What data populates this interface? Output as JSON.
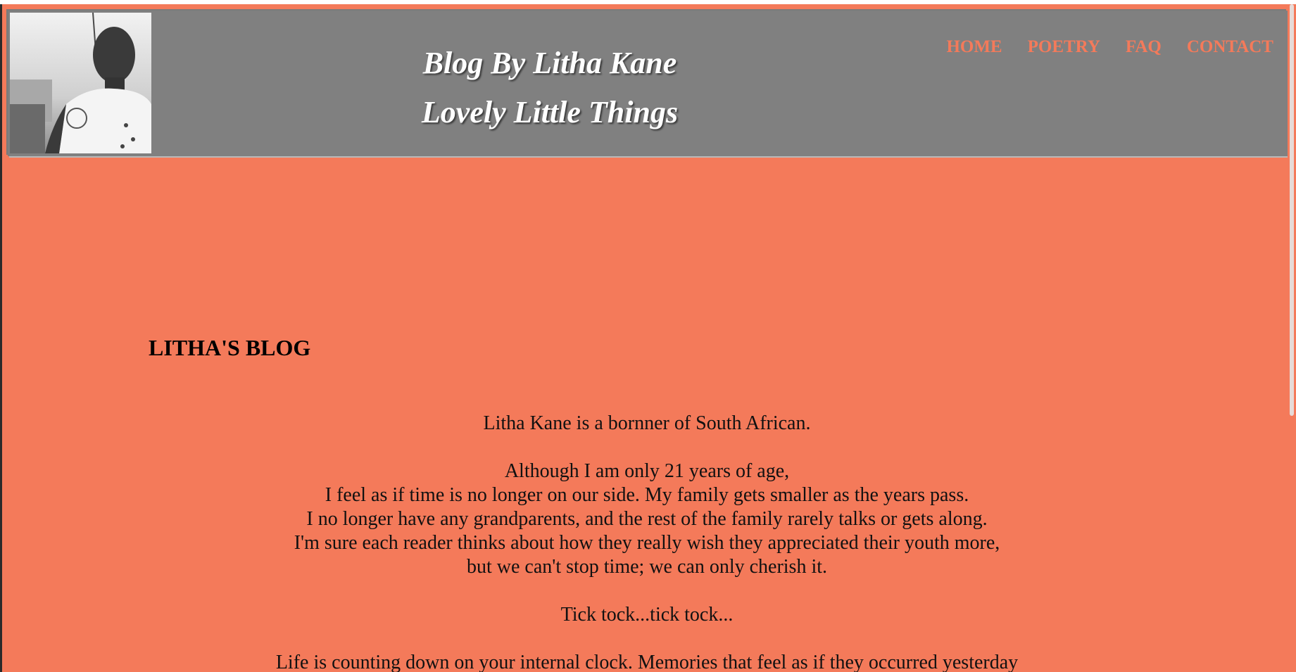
{
  "header": {
    "title": "Blog By Litha Kane",
    "subtitle": "Lovely Little Things",
    "avatar_alt": "Profile photo"
  },
  "nav": {
    "items": [
      {
        "label": "HOME"
      },
      {
        "label": "POETRY"
      },
      {
        "label": "FAQ"
      },
      {
        "label": "CONTACT"
      }
    ]
  },
  "main": {
    "heading": "LITHA'S BLOG",
    "paragraphs": [
      [
        "Litha Kane is a bornner of South African."
      ],
      [
        "Although I am only 21 years of age,",
        "I feel as if time is no longer on our side. My family gets smaller as the years pass.",
        "I no longer have any grandparents, and the rest of the family rarely talks or gets along.",
        "I'm sure each reader thinks about how they really wish they appreciated their youth more,",
        "but we can't stop time; we can only cherish it."
      ],
      [
        "Tick tock...tick tock..."
      ],
      [
        "Life is counting down on your internal clock. Memories that feel as if they occurred yesterday"
      ]
    ]
  },
  "colors": {
    "background": "#f47a5a",
    "header": "#808080",
    "nav_text": "#f47a5a"
  }
}
